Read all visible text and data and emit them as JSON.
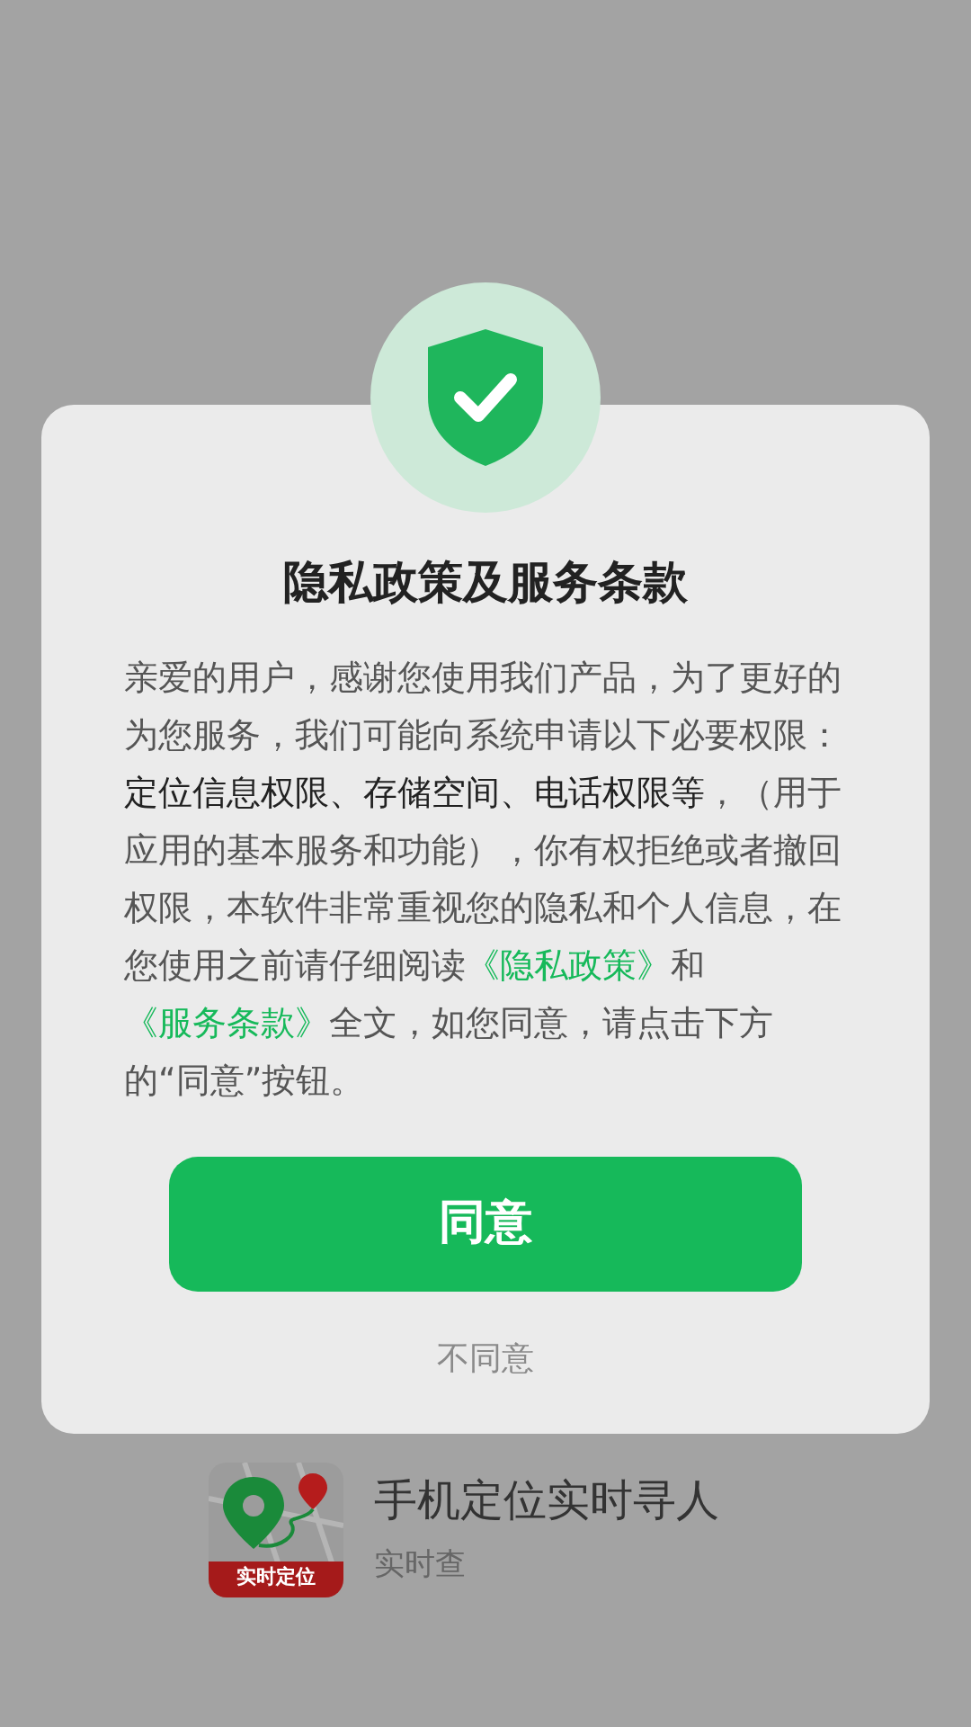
{
  "dialog": {
    "title": "隐私政策及服务条款",
    "message": [
      {
        "kind": "plain",
        "text": "亲爱的用户，感谢您使用我们产品，为了更好的为您服务，我们可能向系统申请以下必要权限："
      },
      {
        "kind": "emphasis",
        "text": "定位信息权限、存储空间、电话权限等"
      },
      {
        "kind": "plain",
        "text": "，（用于应用的基本服务和功能），你有权拒绝或者撤回权限，本软件非常重视您的隐私和个人信息，在您使用之前请仔细阅读"
      },
      {
        "kind": "link",
        "text": "《隐私政策》"
      },
      {
        "kind": "plain",
        "text": "和"
      },
      {
        "kind": "link",
        "text": "《服务条款》"
      },
      {
        "kind": "plain",
        "text": "全文，如您同意，请点击下方的“同意”按钮。"
      }
    ],
    "agree_button": "同意",
    "decline_link": "不同意"
  },
  "app": {
    "icon_label": "实时定位",
    "title": "手机定位实时寻人",
    "subtitle": "实时查"
  }
}
